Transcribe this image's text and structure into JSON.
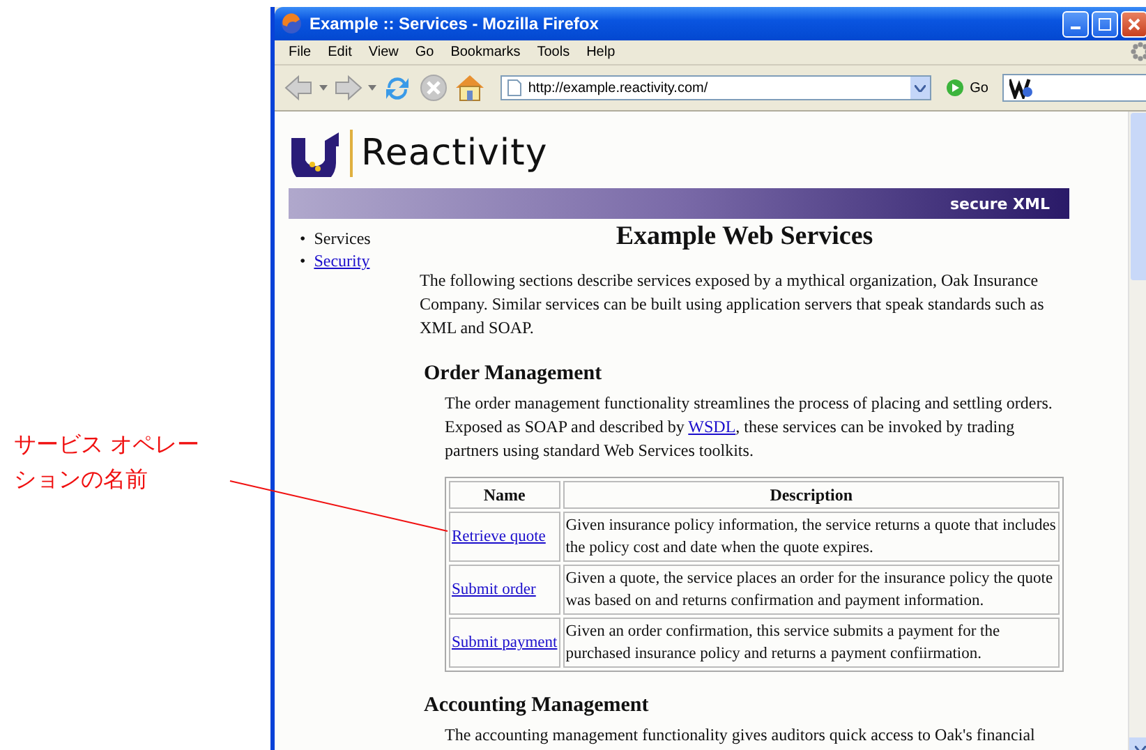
{
  "annotation": {
    "text": "サービス オペレーションの名前"
  },
  "window": {
    "title": "Example :: Services - Mozilla Firefox"
  },
  "menu": [
    "File",
    "Edit",
    "View",
    "Go",
    "Bookmarks",
    "Tools",
    "Help"
  ],
  "toolbar": {
    "url": "http://example.reactivity.com/",
    "go_label": "Go"
  },
  "page": {
    "logo_text": "Reactivity",
    "banner_text": "secure XML",
    "nav": [
      {
        "marker": "•",
        "label": "Services",
        "selected": true
      },
      {
        "marker": "•",
        "label": "Security",
        "selected": false
      }
    ],
    "heading": "Example Web Services",
    "intro": "The following sections describe services exposed by a mythical organization, Oak Insurance Company. Similar services can be built using application servers that speak standards such as XML and SOAP.",
    "sections": [
      {
        "title": "Order Management",
        "text_before": "The order management functionality streamlines the process of placing and settling orders. Exposed as SOAP and described by ",
        "link": "WSDL",
        "text_after": ", these services can be invoked by trading partners using standard Web Services toolkits.",
        "table": {
          "columns": [
            "Name",
            "Description"
          ],
          "rows": [
            {
              "name": "Retrieve quote",
              "description": "Given insurance policy information, the service returns a quote that includes the policy cost and date when the quote expires."
            },
            {
              "name": "Submit order",
              "description": "Given a quote, the service places an order for the insurance policy the quote was based on and returns confirmation and payment information."
            },
            {
              "name": "Submit payment",
              "description": "Given an order confirmation, this service submits a payment for the purchased insurance policy and returns a payment confiirmation."
            }
          ]
        }
      },
      {
        "title": "Accounting Management",
        "text_before": "The accounting management functionality gives auditors quick access to Oak's financial"
      }
    ]
  }
}
